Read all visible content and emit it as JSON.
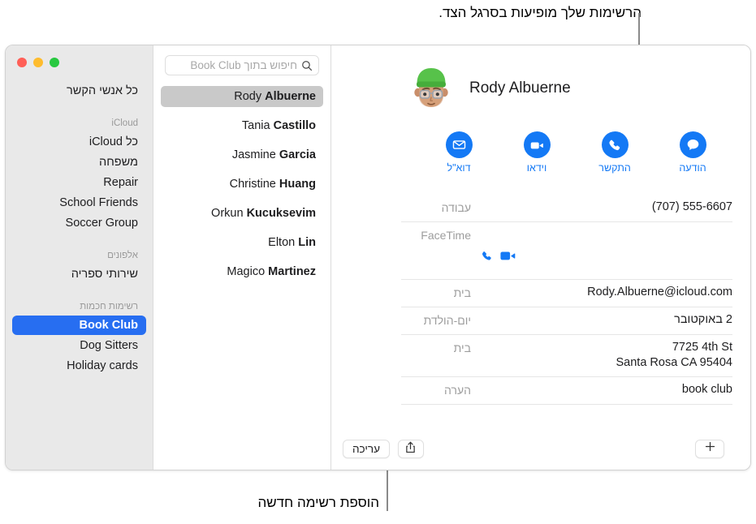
{
  "annotations": {
    "top": "הרשימות שלך מופיעות בסרגל הצד.",
    "bottom": "הוספת רשימה חדשה"
  },
  "window": {
    "traffic_lights": {
      "green": "#28c840",
      "yellow": "#febc2e",
      "red": "#ff5f57"
    }
  },
  "sidebar": {
    "all_contacts": "כל אנשי הקשר",
    "groups": [
      {
        "header": "iCloud",
        "items": [
          {
            "label": "כל iCloud",
            "selected": false
          },
          {
            "label": "משפחה",
            "selected": false
          },
          {
            "label": "Repair",
            "selected": false
          },
          {
            "label": "School Friends",
            "selected": false
          },
          {
            "label": "Soccer Group",
            "selected": false
          }
        ]
      },
      {
        "header": "אלפונים",
        "items": [
          {
            "label": "שירותי ספריה",
            "selected": false
          }
        ]
      },
      {
        "header": "רשימות חכמות",
        "items": [
          {
            "label": "Book Club",
            "selected": true
          },
          {
            "label": "Dog Sitters",
            "selected": false
          },
          {
            "label": "Holiday cards",
            "selected": false
          }
        ]
      }
    ],
    "selection_color": "#276ef1"
  },
  "contact_list": {
    "search": {
      "placeholder": "חיפוש בתוך Book Club",
      "icon": "search-icon"
    },
    "contacts": [
      {
        "first": "Rody ",
        "last": "Albuerne",
        "selected": true,
        "last_bold": false
      },
      {
        "first": "Tania ",
        "last": "Castillo",
        "selected": false,
        "last_bold": true
      },
      {
        "first": "Jasmine ",
        "last": "Garcia",
        "selected": false,
        "last_bold": true
      },
      {
        "first": "Christine ",
        "last": "Huang",
        "selected": false,
        "last_bold": true
      },
      {
        "first": "Orkun ",
        "last": "Kucuksevim",
        "selected": false,
        "last_bold": true
      },
      {
        "first": "Elton ",
        "last": "Lin",
        "selected": false,
        "last_bold": true
      },
      {
        "first": "Magico ",
        "last": "Martinez",
        "selected": false,
        "last_bold": true
      }
    ],
    "selected_row_color": "#c9c9c9"
  },
  "detail": {
    "full_name": "Rody Albuerne",
    "avatar": "memoji-avatar",
    "accent_color": "#1479f5",
    "actions": [
      {
        "label": "הודעה",
        "icon": "message-icon"
      },
      {
        "label": "התקשר",
        "icon": "phone-icon"
      },
      {
        "label": "וידאו",
        "icon": "video-icon"
      },
      {
        "label": "דוא\"ל",
        "icon": "mail-icon"
      }
    ],
    "fields": [
      {
        "label": "עבודה",
        "value": "(707) 555-6607",
        "kind": "text",
        "ltr": true
      },
      {
        "label": "FaceTime",
        "value": "",
        "kind": "facetime",
        "ltr": false
      },
      {
        "label": "בית",
        "value": "Rody.Albuerne@icloud.com",
        "kind": "text",
        "ltr": true
      },
      {
        "label": "יום-הולדת",
        "value": "2 באוקטובר",
        "kind": "text",
        "ltr": false
      },
      {
        "label": "בית",
        "value": "7725 4th St\nSanta Rosa CA 95404",
        "kind": "text",
        "ltr": true
      },
      {
        "label": "הערה",
        "value": "book club",
        "kind": "text",
        "ltr": true
      }
    ],
    "toolbar": {
      "share_icon": "share-icon",
      "edit_label": "עריכה",
      "add_icon": "plus-icon"
    }
  }
}
